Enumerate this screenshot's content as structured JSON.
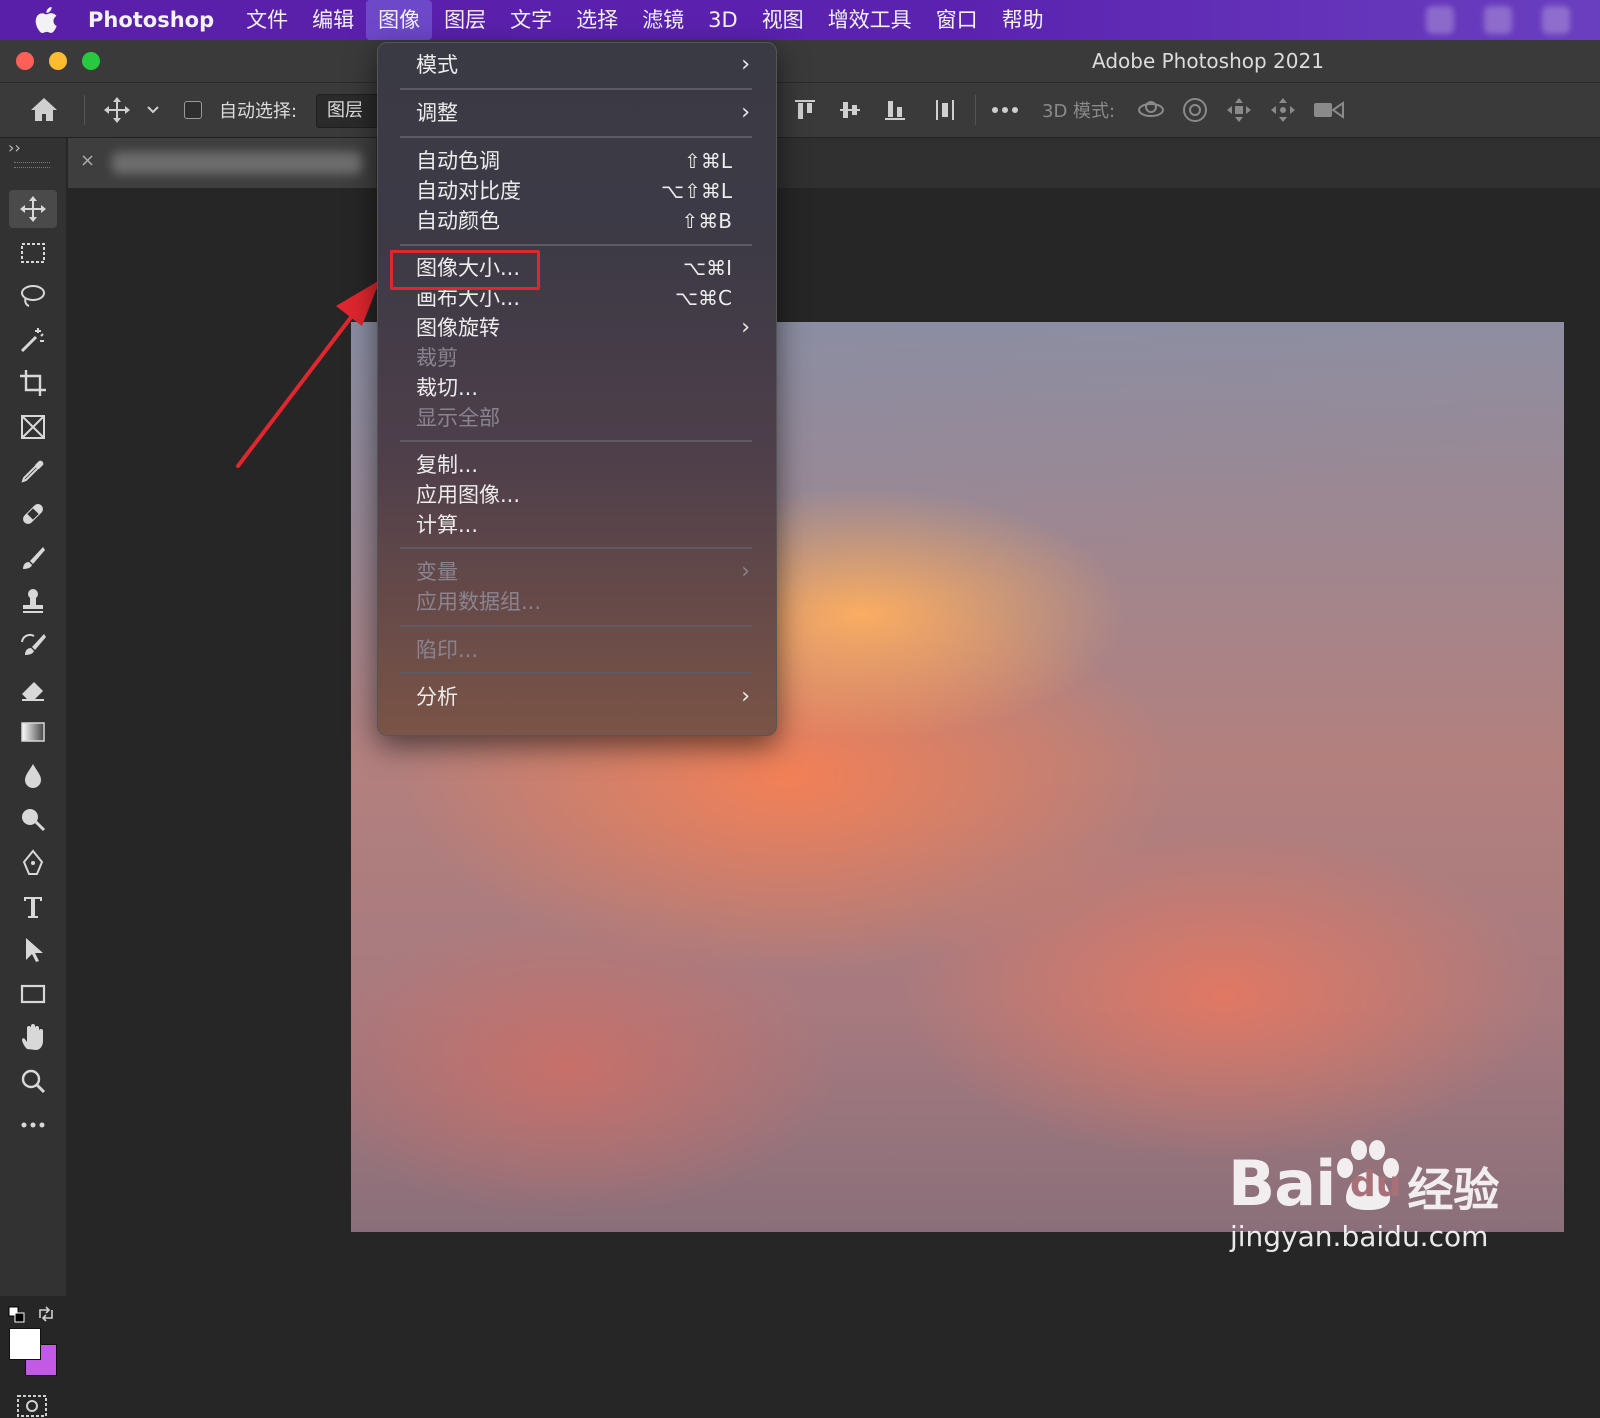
{
  "menubar": {
    "app_name": "Photoshop",
    "items": [
      {
        "label": "文件"
      },
      {
        "label": "编辑"
      },
      {
        "label": "图像",
        "active": true
      },
      {
        "label": "图层"
      },
      {
        "label": "文字"
      },
      {
        "label": "选择"
      },
      {
        "label": "滤镜"
      },
      {
        "label": "3D"
      },
      {
        "label": "视图"
      },
      {
        "label": "增效工具"
      },
      {
        "label": "窗口"
      },
      {
        "label": "帮助"
      }
    ]
  },
  "window": {
    "title": "Adobe Photoshop 2021"
  },
  "options_bar": {
    "auto_select_label": "自动选择:",
    "auto_select_target": "图层",
    "mode_3d_label": "3D 模式:"
  },
  "toolbar": {
    "collapse_glyph": "››",
    "tools": [
      {
        "name": "move-tool",
        "icon": "move-icon",
        "active": true
      },
      {
        "name": "marquee-tool",
        "icon": "rect-marquee-icon"
      },
      {
        "name": "lasso-tool",
        "icon": "lasso-icon"
      },
      {
        "name": "magic-wand-tool",
        "icon": "magic-wand-icon"
      },
      {
        "name": "crop-tool",
        "icon": "crop-icon"
      },
      {
        "name": "frame-tool",
        "icon": "frame-icon"
      },
      {
        "name": "eyedropper-tool",
        "icon": "eyedropper-icon"
      },
      {
        "name": "healing-tool",
        "icon": "bandage-icon"
      },
      {
        "name": "brush-tool",
        "icon": "brush-icon"
      },
      {
        "name": "stamp-tool",
        "icon": "stamp-icon"
      },
      {
        "name": "history-brush-tool",
        "icon": "history-brush-icon"
      },
      {
        "name": "eraser-tool",
        "icon": "eraser-icon"
      },
      {
        "name": "gradient-tool",
        "icon": "gradient-icon"
      },
      {
        "name": "blur-tool",
        "icon": "drop-icon"
      },
      {
        "name": "dodge-tool",
        "icon": "dodge-icon"
      },
      {
        "name": "pen-tool",
        "icon": "pen-icon"
      },
      {
        "name": "type-tool",
        "icon": "type-icon"
      },
      {
        "name": "path-select-tool",
        "icon": "arrow-cursor-icon"
      },
      {
        "name": "shape-tool",
        "icon": "rectangle-icon"
      },
      {
        "name": "hand-tool",
        "icon": "hand-icon"
      },
      {
        "name": "zoom-tool",
        "icon": "magnifier-icon"
      },
      {
        "name": "more-tools",
        "icon": "ellipsis-icon"
      }
    ],
    "foreground_color": "#ffffff",
    "background_color": "#c35ae6"
  },
  "tab": {
    "close_glyph": "×"
  },
  "image_menu": {
    "items": [
      {
        "label": "模式",
        "submenu": true
      },
      {
        "label": "调整",
        "submenu": true
      },
      {
        "label": "自动色调",
        "shortcut": "⇧⌘L"
      },
      {
        "label": "自动对比度",
        "shortcut": "⌥⇧⌘L"
      },
      {
        "label": "自动颜色",
        "shortcut": "⇧⌘B"
      },
      {
        "label": "图像大小...",
        "shortcut": "⌥⌘I",
        "highlighted": true
      },
      {
        "label": "画布大小...",
        "shortcut": "⌥⌘C"
      },
      {
        "label": "图像旋转",
        "submenu": true
      },
      {
        "label": "裁剪",
        "disabled": true
      },
      {
        "label": "裁切..."
      },
      {
        "label": "显示全部",
        "disabled": true
      },
      {
        "label": "复制..."
      },
      {
        "label": "应用图像..."
      },
      {
        "label": "计算..."
      },
      {
        "label": "变量",
        "submenu": true,
        "disabled": true
      },
      {
        "label": "应用数据组...",
        "disabled": true
      },
      {
        "label": "陷印...",
        "disabled": true
      },
      {
        "label": "分析",
        "submenu": true
      }
    ],
    "submenu_glyph": "›",
    "highlight_color": "#e0262e"
  },
  "watermark": {
    "logo_bai": "Bai",
    "logo_du": "du",
    "logo_jingyan": "经验",
    "url": "jingyan.baidu.com"
  },
  "colors": {
    "menubar": "#5a1fa8",
    "panel": "#3a3a3a",
    "workspace": "#262626",
    "arrow": "#e0262e"
  }
}
